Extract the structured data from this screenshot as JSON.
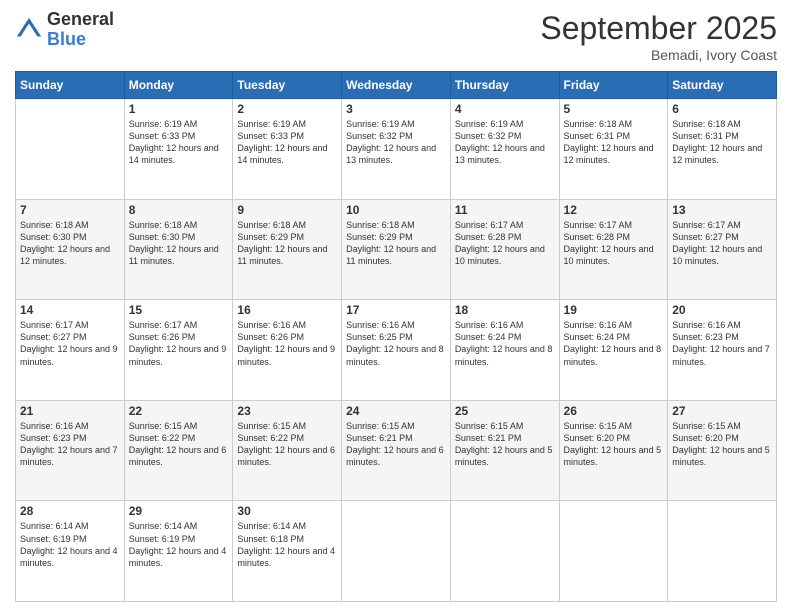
{
  "header": {
    "logo_general": "General",
    "logo_blue": "Blue",
    "month_title": "September 2025",
    "location": "Bemadi, Ivory Coast"
  },
  "weekdays": [
    "Sunday",
    "Monday",
    "Tuesday",
    "Wednesday",
    "Thursday",
    "Friday",
    "Saturday"
  ],
  "weeks": [
    [
      {
        "day": "",
        "sunrise": "",
        "sunset": "",
        "daylight": ""
      },
      {
        "day": "1",
        "sunrise": "Sunrise: 6:19 AM",
        "sunset": "Sunset: 6:33 PM",
        "daylight": "Daylight: 12 hours and 14 minutes."
      },
      {
        "day": "2",
        "sunrise": "Sunrise: 6:19 AM",
        "sunset": "Sunset: 6:33 PM",
        "daylight": "Daylight: 12 hours and 14 minutes."
      },
      {
        "day": "3",
        "sunrise": "Sunrise: 6:19 AM",
        "sunset": "Sunset: 6:32 PM",
        "daylight": "Daylight: 12 hours and 13 minutes."
      },
      {
        "day": "4",
        "sunrise": "Sunrise: 6:19 AM",
        "sunset": "Sunset: 6:32 PM",
        "daylight": "Daylight: 12 hours and 13 minutes."
      },
      {
        "day": "5",
        "sunrise": "Sunrise: 6:18 AM",
        "sunset": "Sunset: 6:31 PM",
        "daylight": "Daylight: 12 hours and 12 minutes."
      },
      {
        "day": "6",
        "sunrise": "Sunrise: 6:18 AM",
        "sunset": "Sunset: 6:31 PM",
        "daylight": "Daylight: 12 hours and 12 minutes."
      }
    ],
    [
      {
        "day": "7",
        "sunrise": "Sunrise: 6:18 AM",
        "sunset": "Sunset: 6:30 PM",
        "daylight": "Daylight: 12 hours and 12 minutes."
      },
      {
        "day": "8",
        "sunrise": "Sunrise: 6:18 AM",
        "sunset": "Sunset: 6:30 PM",
        "daylight": "Daylight: 12 hours and 11 minutes."
      },
      {
        "day": "9",
        "sunrise": "Sunrise: 6:18 AM",
        "sunset": "Sunset: 6:29 PM",
        "daylight": "Daylight: 12 hours and 11 minutes."
      },
      {
        "day": "10",
        "sunrise": "Sunrise: 6:18 AM",
        "sunset": "Sunset: 6:29 PM",
        "daylight": "Daylight: 12 hours and 11 minutes."
      },
      {
        "day": "11",
        "sunrise": "Sunrise: 6:17 AM",
        "sunset": "Sunset: 6:28 PM",
        "daylight": "Daylight: 12 hours and 10 minutes."
      },
      {
        "day": "12",
        "sunrise": "Sunrise: 6:17 AM",
        "sunset": "Sunset: 6:28 PM",
        "daylight": "Daylight: 12 hours and 10 minutes."
      },
      {
        "day": "13",
        "sunrise": "Sunrise: 6:17 AM",
        "sunset": "Sunset: 6:27 PM",
        "daylight": "Daylight: 12 hours and 10 minutes."
      }
    ],
    [
      {
        "day": "14",
        "sunrise": "Sunrise: 6:17 AM",
        "sunset": "Sunset: 6:27 PM",
        "daylight": "Daylight: 12 hours and 9 minutes."
      },
      {
        "day": "15",
        "sunrise": "Sunrise: 6:17 AM",
        "sunset": "Sunset: 6:26 PM",
        "daylight": "Daylight: 12 hours and 9 minutes."
      },
      {
        "day": "16",
        "sunrise": "Sunrise: 6:16 AM",
        "sunset": "Sunset: 6:26 PM",
        "daylight": "Daylight: 12 hours and 9 minutes."
      },
      {
        "day": "17",
        "sunrise": "Sunrise: 6:16 AM",
        "sunset": "Sunset: 6:25 PM",
        "daylight": "Daylight: 12 hours and 8 minutes."
      },
      {
        "day": "18",
        "sunrise": "Sunrise: 6:16 AM",
        "sunset": "Sunset: 6:24 PM",
        "daylight": "Daylight: 12 hours and 8 minutes."
      },
      {
        "day": "19",
        "sunrise": "Sunrise: 6:16 AM",
        "sunset": "Sunset: 6:24 PM",
        "daylight": "Daylight: 12 hours and 8 minutes."
      },
      {
        "day": "20",
        "sunrise": "Sunrise: 6:16 AM",
        "sunset": "Sunset: 6:23 PM",
        "daylight": "Daylight: 12 hours and 7 minutes."
      }
    ],
    [
      {
        "day": "21",
        "sunrise": "Sunrise: 6:16 AM",
        "sunset": "Sunset: 6:23 PM",
        "daylight": "Daylight: 12 hours and 7 minutes."
      },
      {
        "day": "22",
        "sunrise": "Sunrise: 6:15 AM",
        "sunset": "Sunset: 6:22 PM",
        "daylight": "Daylight: 12 hours and 6 minutes."
      },
      {
        "day": "23",
        "sunrise": "Sunrise: 6:15 AM",
        "sunset": "Sunset: 6:22 PM",
        "daylight": "Daylight: 12 hours and 6 minutes."
      },
      {
        "day": "24",
        "sunrise": "Sunrise: 6:15 AM",
        "sunset": "Sunset: 6:21 PM",
        "daylight": "Daylight: 12 hours and 6 minutes."
      },
      {
        "day": "25",
        "sunrise": "Sunrise: 6:15 AM",
        "sunset": "Sunset: 6:21 PM",
        "daylight": "Daylight: 12 hours and 5 minutes."
      },
      {
        "day": "26",
        "sunrise": "Sunrise: 6:15 AM",
        "sunset": "Sunset: 6:20 PM",
        "daylight": "Daylight: 12 hours and 5 minutes."
      },
      {
        "day": "27",
        "sunrise": "Sunrise: 6:15 AM",
        "sunset": "Sunset: 6:20 PM",
        "daylight": "Daylight: 12 hours and 5 minutes."
      }
    ],
    [
      {
        "day": "28",
        "sunrise": "Sunrise: 6:14 AM",
        "sunset": "Sunset: 6:19 PM",
        "daylight": "Daylight: 12 hours and 4 minutes."
      },
      {
        "day": "29",
        "sunrise": "Sunrise: 6:14 AM",
        "sunset": "Sunset: 6:19 PM",
        "daylight": "Daylight: 12 hours and 4 minutes."
      },
      {
        "day": "30",
        "sunrise": "Sunrise: 6:14 AM",
        "sunset": "Sunset: 6:18 PM",
        "daylight": "Daylight: 12 hours and 4 minutes."
      },
      {
        "day": "",
        "sunrise": "",
        "sunset": "",
        "daylight": ""
      },
      {
        "day": "",
        "sunrise": "",
        "sunset": "",
        "daylight": ""
      },
      {
        "day": "",
        "sunrise": "",
        "sunset": "",
        "daylight": ""
      },
      {
        "day": "",
        "sunrise": "",
        "sunset": "",
        "daylight": ""
      }
    ]
  ]
}
